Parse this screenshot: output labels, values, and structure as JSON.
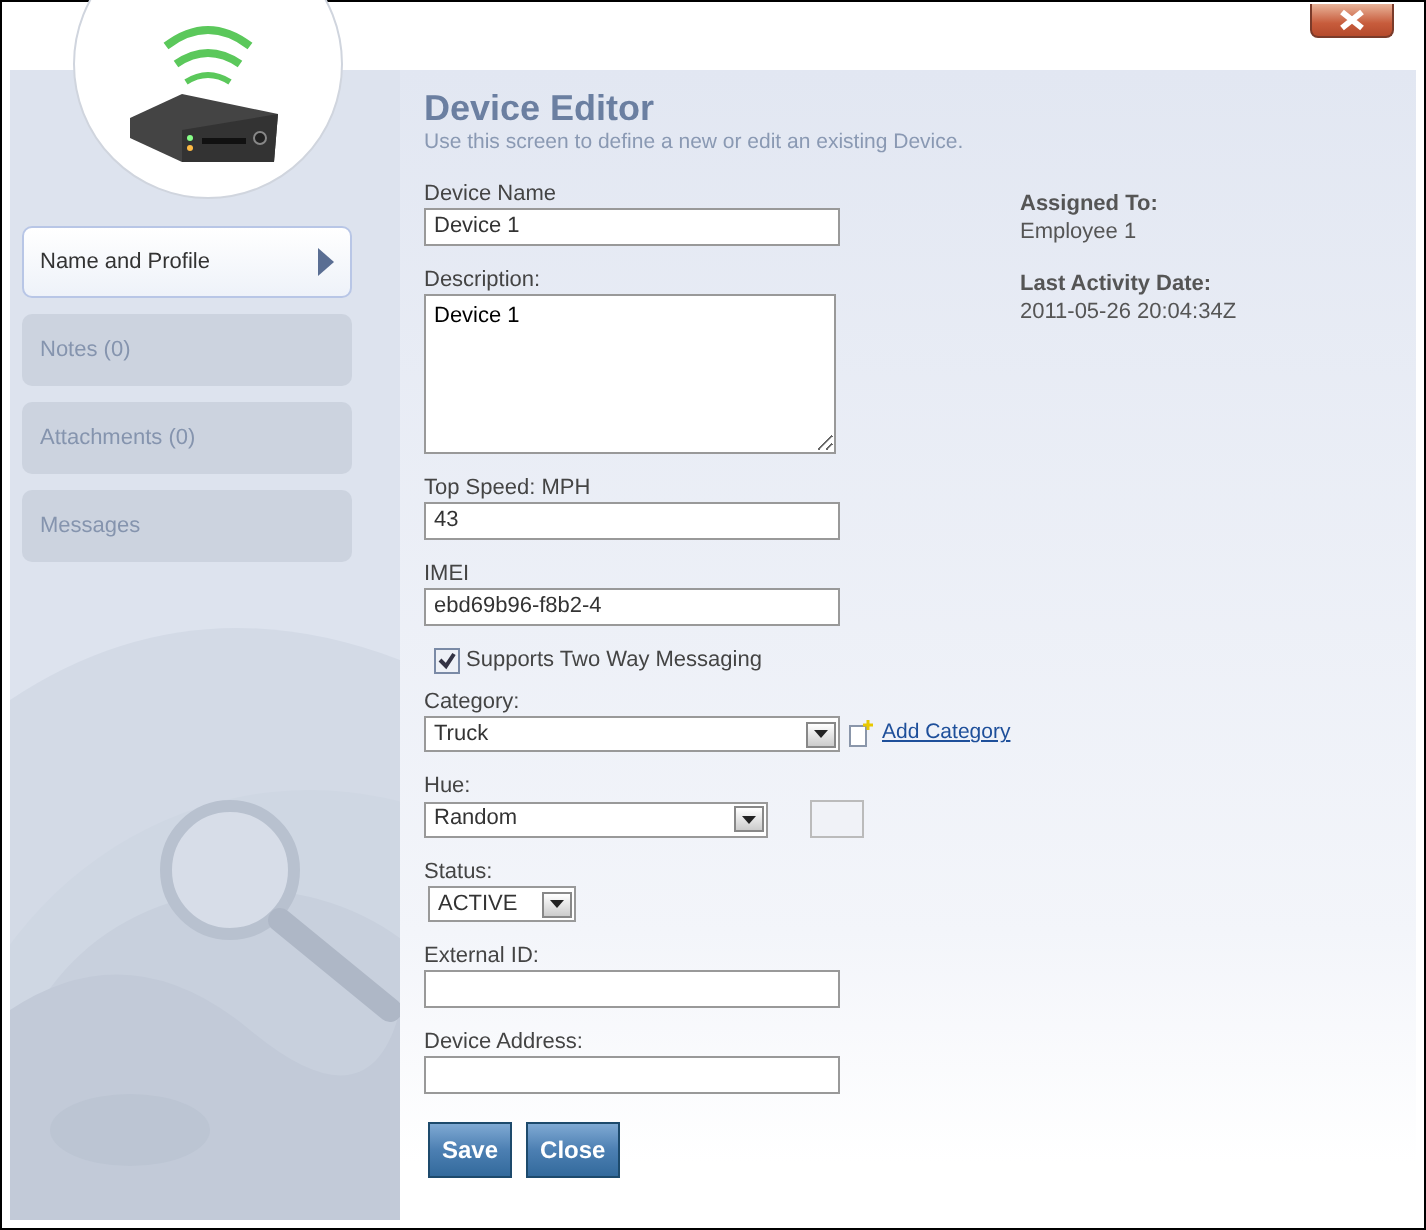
{
  "sidebar": {
    "items": [
      {
        "label": "Name and Profile",
        "selected": true
      },
      {
        "label": "Notes (0)",
        "selected": false
      },
      {
        "label": "Attachments (0)",
        "selected": false
      },
      {
        "label": "Messages",
        "selected": false
      }
    ]
  },
  "header": {
    "title": "Device Editor",
    "subtitle": "Use this screen to define a new or edit an existing Device."
  },
  "form": {
    "fields": [
      {
        "kind": "text",
        "label": "Device Name",
        "value": "Device 1"
      },
      {
        "kind": "textarea",
        "label": "Description:",
        "value": "Device 1"
      },
      {
        "kind": "text",
        "label": "Top Speed: MPH",
        "value": "43"
      },
      {
        "kind": "text",
        "label": "IMEI",
        "value": "ebd69b96-f8b2-4"
      },
      {
        "kind": "checkbox",
        "label": "Supports Two Way Messaging",
        "checked": true
      },
      {
        "kind": "select",
        "label": "Category:",
        "value": "Truck",
        "link": "Add Category"
      },
      {
        "kind": "select",
        "label": "Hue:",
        "value": "Random",
        "swatch": true
      },
      {
        "kind": "select",
        "label": "Status:",
        "value": "ACTIVE"
      },
      {
        "kind": "text",
        "label": "External ID:"
      },
      {
        "kind": "text",
        "label": "Device Address:"
      }
    ]
  },
  "info": [
    {
      "label": "Assigned To:",
      "value": "Employee 1"
    },
    {
      "label": "Last Activity Date:",
      "value": "2011-05-26 20:04:34Z"
    }
  ],
  "buttons": [
    "Save",
    "Close"
  ]
}
